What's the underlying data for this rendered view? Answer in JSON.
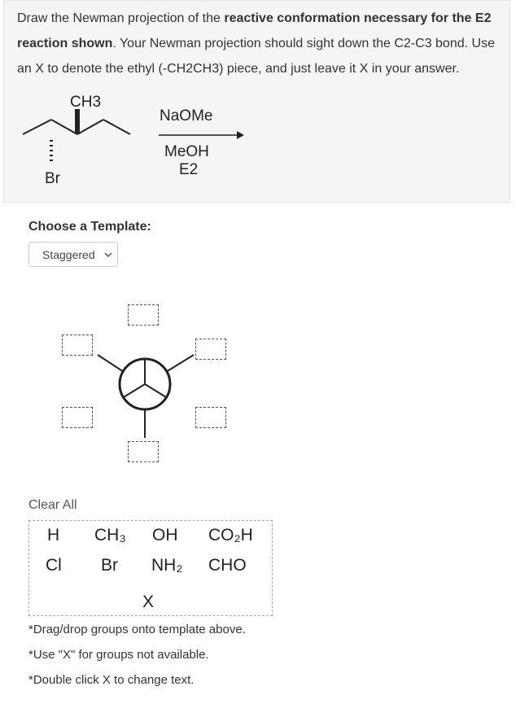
{
  "question": {
    "line1_a": "Draw the Newman projection of the ",
    "line1_b": "reactive conformation necessary for the E2",
    "line2_a": "reaction shown",
    "line2_b": ". Your Newman projection should sight down the C2-C3 bond. Use",
    "line3": "an X to denote the ethyl (-CH2CH3) piece, and just leave it X in your answer."
  },
  "molecule": {
    "methyl_label": "CH3",
    "bromine_label": "Br"
  },
  "reaction": {
    "reagent_top": "NaOMe",
    "solvent": "MeOH",
    "mechanism": "E2"
  },
  "template": {
    "label": "Choose a Template:",
    "selected": "Staggered"
  },
  "palette": {
    "clear_all": "Clear All",
    "groups": [
      "H",
      "CH₃",
      "OH",
      "CO₂H",
      "Cl",
      "Br",
      "NH₂",
      "CHO",
      "X"
    ]
  },
  "notes": [
    "*Drag/drop groups onto template above.",
    "*Use \"X\" for groups not available.",
    "*Double click X to change text."
  ]
}
